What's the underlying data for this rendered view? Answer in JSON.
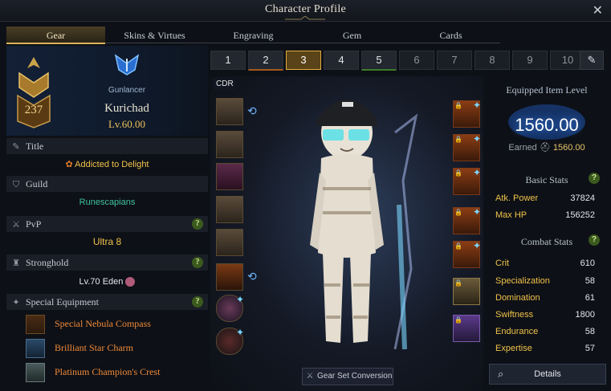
{
  "window": {
    "title": "Character Profile",
    "close_icon": "✕"
  },
  "tabs": [
    {
      "label": "Gear"
    },
    {
      "label": "Skins & Virtues"
    },
    {
      "label": "Engraving"
    },
    {
      "label": "Gem"
    },
    {
      "label": "Cards"
    }
  ],
  "character": {
    "roster_level": "237",
    "class_name": "Gunlancer",
    "name": "Kurichad",
    "level": "Lv.60.00"
  },
  "sections": {
    "title": {
      "label": "Title",
      "value": "Addicted to Delight"
    },
    "guild": {
      "label": "Guild",
      "value": "Runescapians"
    },
    "pvp": {
      "label": "PvP",
      "value": "Ultra 8"
    },
    "stronghold": {
      "label": "Stronghold",
      "value": "Lv.70 Eden"
    },
    "special_equipment": {
      "label": "Special Equipment",
      "items": [
        {
          "name": "Special Nebula Compass"
        },
        {
          "name": "Brilliant Star Charm"
        },
        {
          "name": "Platinum Champion's Crest"
        }
      ]
    }
  },
  "preset_slots": [
    "1",
    "2",
    "3",
    "4",
    "5",
    "6",
    "7",
    "8",
    "9",
    "10"
  ],
  "selected_slot": "3",
  "center": {
    "cdr_label": "CDR",
    "gear_set_button": "Gear Set Conversion"
  },
  "item_level": {
    "title": "Equipped Item Level",
    "value": "1560.00",
    "earned_label": "Earned",
    "earned_value": "1560.00"
  },
  "basic_stats": {
    "title": "Basic Stats",
    "rows": [
      {
        "k": "Atk. Power",
        "v": "37824"
      },
      {
        "k": "Max HP",
        "v": "156252"
      }
    ]
  },
  "combat_stats": {
    "title": "Combat Stats",
    "rows": [
      {
        "k": "Crit",
        "v": "610"
      },
      {
        "k": "Specialization",
        "v": "58"
      },
      {
        "k": "Domination",
        "v": "61"
      },
      {
        "k": "Swiftness",
        "v": "1800"
      },
      {
        "k": "Endurance",
        "v": "58"
      },
      {
        "k": "Expertise",
        "v": "57"
      }
    ]
  },
  "details_button": "Details",
  "help_glyph": "?",
  "colors": {
    "accent_gold": "#e3ad3b",
    "item_level_blue": "#3b8cff",
    "stat_gold": "#f0c24a"
  }
}
